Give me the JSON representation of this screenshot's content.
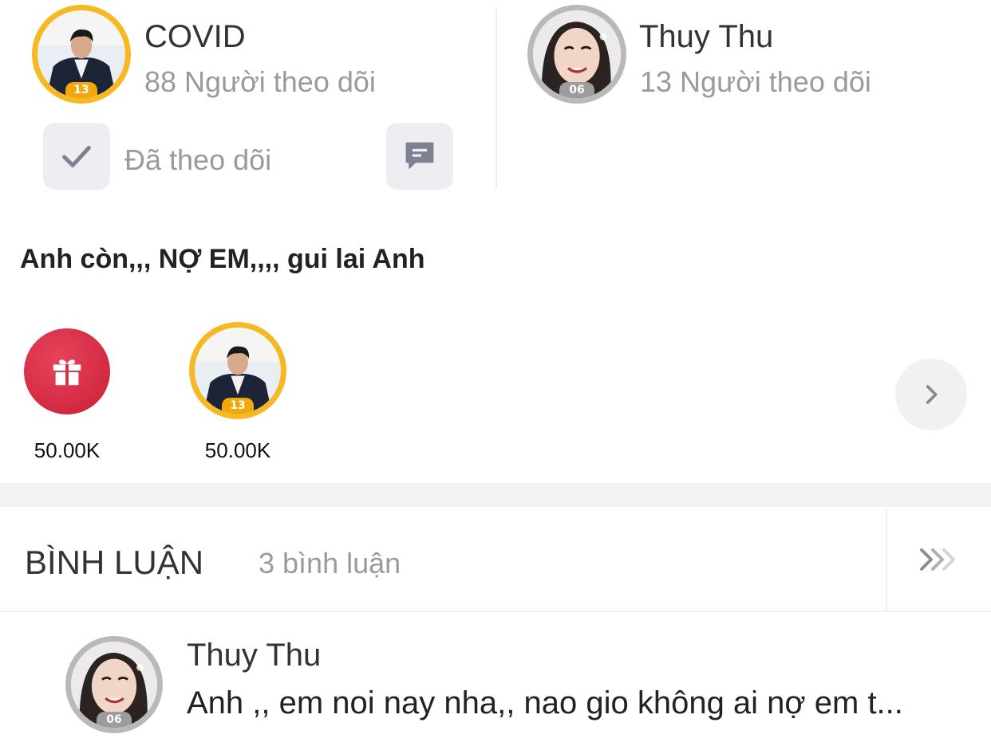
{
  "hosts": [
    {
      "name": "COVID",
      "followers": "88 Người theo dõi",
      "level": "13"
    },
    {
      "name": "Thuy Thu",
      "followers": "13 Người theo dõi",
      "level": "06"
    }
  ],
  "follow": {
    "label": "Đã theo dõi"
  },
  "post": {
    "text": "Anh còn,,, NỢ EM,,,, gui lai Anh"
  },
  "gifts": [
    {
      "value": "50.00K",
      "icon": "gift-icon"
    },
    {
      "value": "50.00K",
      "level": "13",
      "icon": "avatar"
    }
  ],
  "comments": {
    "title": "BÌNH LUẬN",
    "count": "3 bình luận",
    "items": [
      {
        "author": "Thuy Thu",
        "level": "06",
        "text": "Anh ,, em noi nay nha,, nao gio không ai nợ em t..."
      }
    ]
  },
  "colors": {
    "gold": "#f6b923",
    "silver": "#b9b9b9",
    "gift_red": "#dc2a45",
    "muted": "#9a9a9a"
  }
}
